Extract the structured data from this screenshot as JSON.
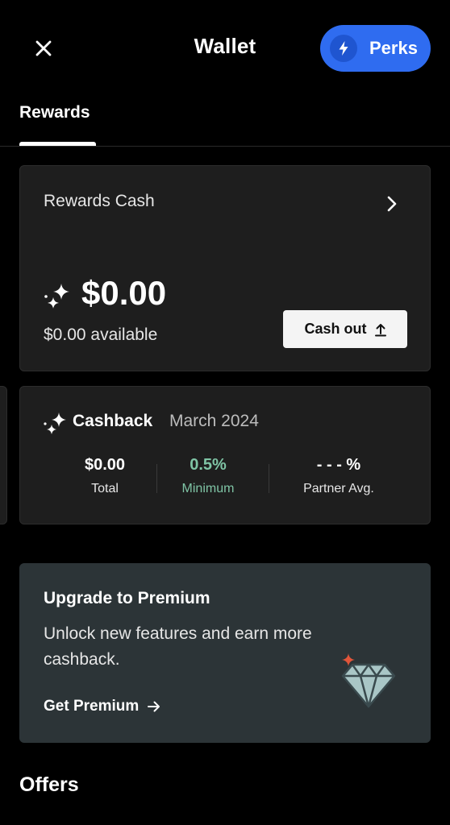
{
  "header": {
    "title": "Wallet",
    "close_icon": "close-icon",
    "perks_label": "Perks",
    "perks_icon": "lightning-bolt-icon",
    "perks_color": "#2f6cf0"
  },
  "tabs": [
    {
      "label": "Rewards",
      "active": true
    }
  ],
  "rewards_cash": {
    "title": "Rewards Cash",
    "amount": "$0.00",
    "available": "$0.00 available",
    "cashout_label": "Cash out"
  },
  "cashback": {
    "title": "Cashback",
    "period": "March 2024",
    "stats": [
      {
        "value": "$0.00",
        "label": "Total"
      },
      {
        "value": "0.5%",
        "label": "Minimum"
      },
      {
        "value": "- - - %",
        "label": "Partner Avg."
      }
    ],
    "accent_color": "#7fc4a5"
  },
  "premium": {
    "title": "Upgrade to Premium",
    "description": "Unlock new features and earn more cashback.",
    "link_label": "Get Premium",
    "icon": "diamond-icon"
  },
  "offers": {
    "title": "Offers"
  }
}
